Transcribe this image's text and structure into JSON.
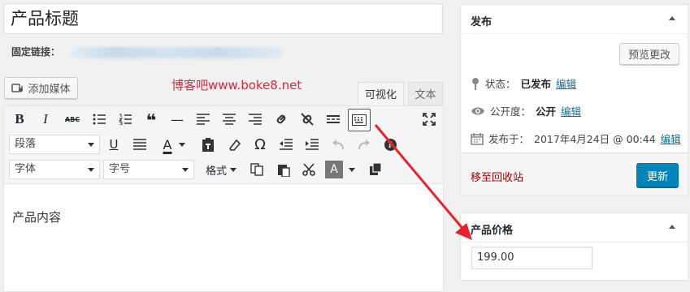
{
  "post": {
    "title": "产品标题",
    "permalink_label": "固定链接：",
    "content": "产品内容"
  },
  "media": {
    "add_label": "添加媒体"
  },
  "watermark": "博客吧www.boke8.net",
  "tabs": {
    "visual": "可视化",
    "text": "文本"
  },
  "toolbar": {
    "bold": "B",
    "italic": "I",
    "strike": "ABC",
    "blockquote": "❝",
    "hr": "—",
    "underline": "U",
    "text_color": "A",
    "omega": "Ω",
    "help": "?",
    "bg_color": "A",
    "format_select": "段落",
    "font_select": "字体",
    "size_select": "字号",
    "formats_label": "格式"
  },
  "publish": {
    "header": "发布",
    "preview_label": "预览更改",
    "status_label": "状态：",
    "status_value": "已发布",
    "visibility_label": "公开度：",
    "visibility_value": "公开",
    "published_label": "发布于：",
    "published_value": "2017年4月24日 @ 00:44",
    "edit_label": "编辑",
    "trash_label": "移至回收站",
    "update_label": "更新"
  },
  "price": {
    "header": "产品价格",
    "value": "199.00"
  },
  "colors": {
    "accent": "#0085ba",
    "link": "#0073aa",
    "trash": "#aa0000",
    "watermark": "#e0253c",
    "annotation_arrow": "#e8212e"
  }
}
